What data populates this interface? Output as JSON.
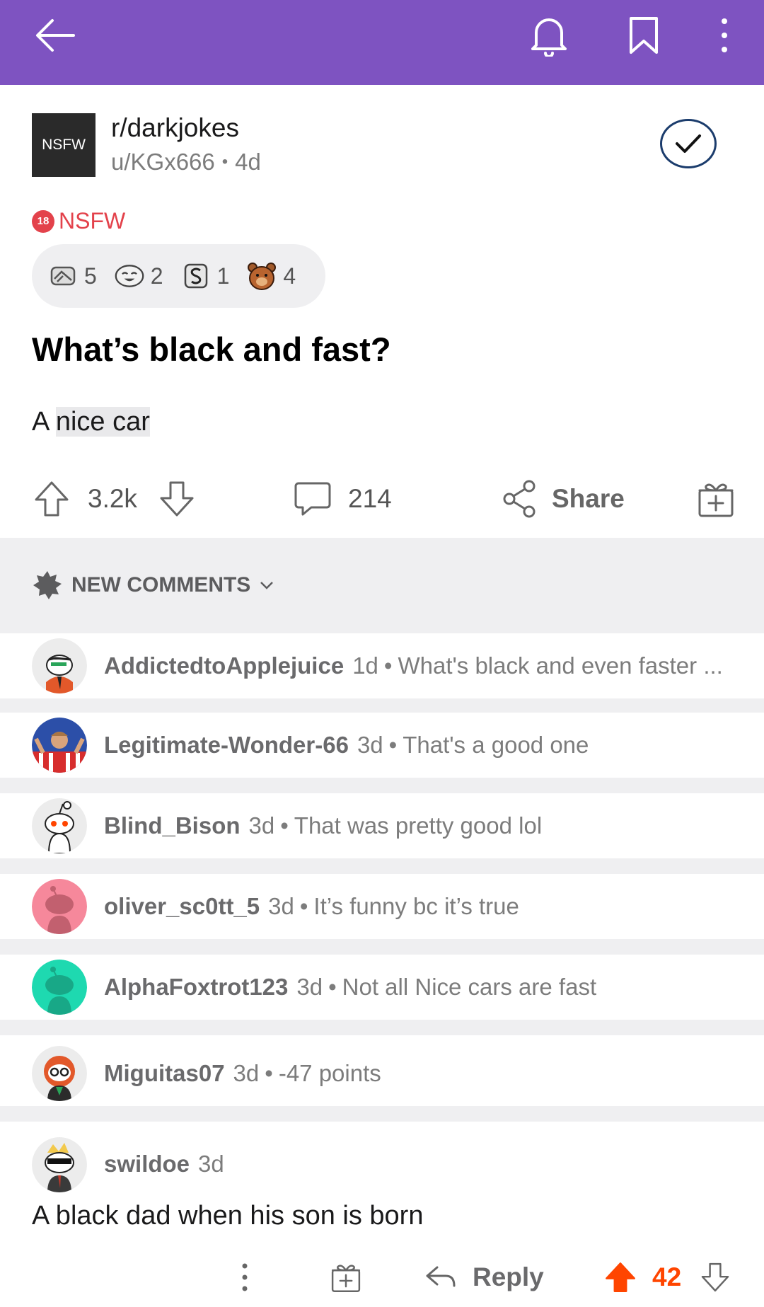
{
  "header": {
    "back_icon": "back-arrow-icon",
    "bell_icon": "bell-icon",
    "bookmark_icon": "bookmark-icon",
    "more_icon": "more-vertical-icon"
  },
  "post": {
    "community_avatar_text": "NSFW",
    "community": "r/darkjokes",
    "author": "u/KGx666",
    "meta_sep": "•",
    "age": "4d",
    "nsfw_badge": "18",
    "nsfw_label": "NSFW",
    "awards": [
      {
        "icon": "handshake-award-icon",
        "count": "5"
      },
      {
        "icon": "laughing-award-icon",
        "count": "2"
      },
      {
        "icon": "silver-award-icon",
        "count": "1"
      },
      {
        "icon": "bear-award-icon",
        "count": "4"
      }
    ],
    "title": "What’s black and fast?",
    "body_before": "A ",
    "body_highlight": "nice car",
    "score": "3.2k",
    "comments": "214",
    "share_label": "Share"
  },
  "sort": {
    "label": "NEW COMMENTS"
  },
  "comments": [
    {
      "user": "AddictedtoApplejuice",
      "time": "1d",
      "sep": "•",
      "preview": "What's black and even faster ..."
    },
    {
      "user": "Legitimate-Wonder-66",
      "time": "3d",
      "sep": "•",
      "preview": "That's a good one"
    },
    {
      "user": "Blind_Bison",
      "time": "3d",
      "sep": "•",
      "preview": "That was pretty good lol"
    },
    {
      "user": "oliver_sc0tt_5",
      "time": "3d",
      "sep": "•",
      "preview": "It’s funny bc it’s true"
    },
    {
      "user": "AlphaFoxtrot123",
      "time": "3d",
      "sep": "•",
      "preview": "Not all Nice cars are fast"
    },
    {
      "user": "Miguitas07",
      "time": "3d",
      "sep": "•",
      "preview": "-47 points"
    }
  ],
  "expanded_comment": {
    "user": "swildoe",
    "time": "3d",
    "body": "A black dad when his son is born",
    "reply_label": "Reply",
    "score": "42"
  },
  "colors": {
    "header_bg": "#7e53c1",
    "nsfw": "#e3424b",
    "upvote": "#ff4500",
    "band": "#efeff1"
  }
}
